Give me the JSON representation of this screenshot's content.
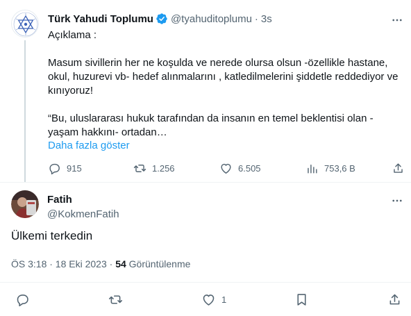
{
  "quoted_tweet": {
    "author_name": "Türk Yahudi Toplumu",
    "handle": "@tyahuditoplumu",
    "separator": "·",
    "time": "3s",
    "text_lines": [
      "Açıklama :",
      "",
      "Masum sivillerin her ne koşulda ve nerede olursa olsun -özellikle hastane, okul, huzurevi vb- hedef alınmalarını , katledilmelerini şiddetle reddediyor ve kınıyoruz!",
      "",
      "“Bu, uluslararası hukuk tarafından da insanın en temel beklentisi olan -yaşam hakkını- ortadan…"
    ],
    "show_more": "Daha fazla göster",
    "stats": {
      "replies": "915",
      "retweets": "1.256",
      "likes": "6.505",
      "views": "753,6 B"
    },
    "icons": {
      "verified": "verified-badge-icon",
      "more": "more-icon"
    }
  },
  "main_tweet": {
    "author_name": "Fatih",
    "handle": "@KokmenFatih",
    "text": "Ülkemi terkedin",
    "timestamp": "ÖS 3:18 · 18 Eki 2023 · ",
    "views_count": "54",
    "views_label": " Görüntülenme",
    "stats": {
      "likes": "1"
    }
  },
  "colors": {
    "accent": "#1d9bf0",
    "secondary_text": "#536471",
    "primary_text": "#0f1419",
    "divider": "#eff3f4"
  }
}
